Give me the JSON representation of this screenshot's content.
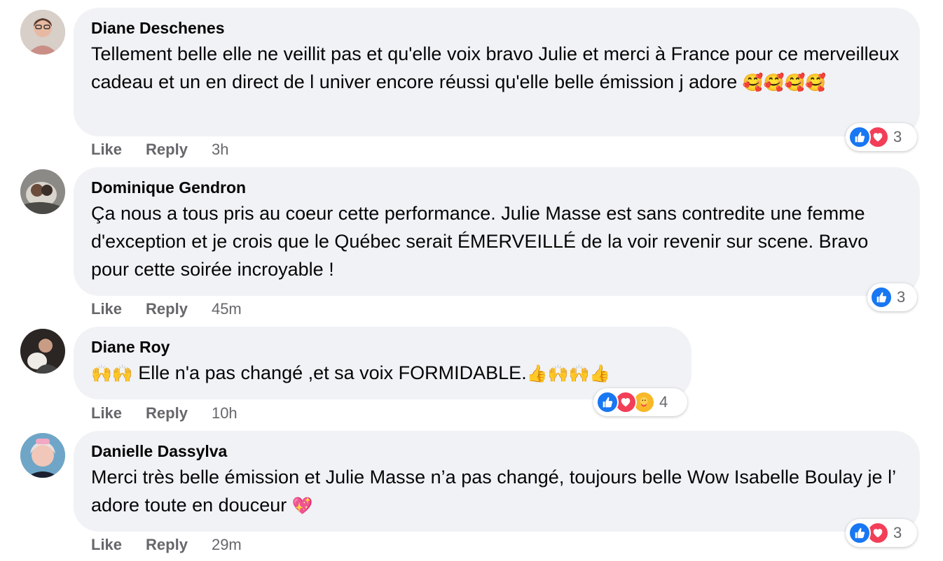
{
  "comments": [
    {
      "author": "Diane Deschenes",
      "text": "Tellement belle elle ne veillit pas et qu'elle voix bravo Julie et merci à France pour ce merveilleux cadeau et un en direct de l univer encore réussi qu'elle belle émission j adore",
      "emoji": "🥰🥰🥰🥰",
      "like_label": "Like",
      "reply_label": "Reply",
      "time": "3h",
      "reaction_count": "3",
      "reactions": [
        "like-icon",
        "love-icon"
      ]
    },
    {
      "author": "Dominique Gendron",
      "text": "Ça nous a tous pris au coeur cette performance. Julie Masse est sans contredite une femme d'exception et je crois que le Québec serait ÉMERVEILLÉ de la voir revenir sur scene. Bravo pour cette soirée incroyable !",
      "like_label": "Like",
      "reply_label": "Reply",
      "time": "45m",
      "reaction_count": "3",
      "reactions": [
        "like-icon"
      ]
    },
    {
      "author": "Diane Roy",
      "emoji_prefix": "🙌🙌",
      "text": "Elle n'a pas changé ,et sa voix FORMIDABLE.",
      "emoji_suffix": "👍🙌🙌👍",
      "like_label": "Like",
      "reply_label": "Reply",
      "time": "10h",
      "reaction_count": "4",
      "reactions": [
        "like-icon",
        "love-icon",
        "care-icon"
      ]
    },
    {
      "author": "Danielle Dassylva",
      "text": "Merci très belle émission et Julie Masse n’a pas changé, toujours belle Wow Isabelle Boulay je l’ adore toute en douceur",
      "emoji": "💖",
      "like_label": "Like",
      "reply_label": "Reply",
      "time": "29m",
      "reaction_count": "3",
      "reactions": [
        "like-icon",
        "love-icon"
      ]
    }
  ],
  "colors": {
    "bubble": "#f0f2f5",
    "meta_text": "#65676b",
    "like_blue": "#1877f2",
    "love_red": "#f33e58",
    "care_yellow": "#f7b928"
  }
}
